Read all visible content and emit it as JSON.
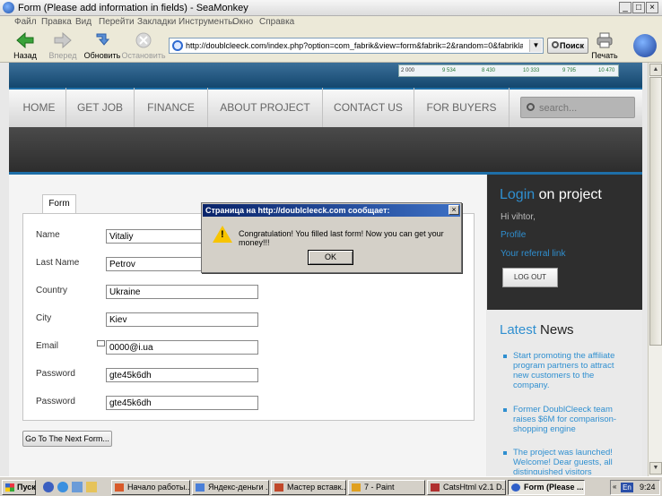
{
  "window": {
    "title": "Form (Please add information in fields) - SeaMonkey"
  },
  "menu": [
    "Файл",
    "Правка",
    "Вид",
    "Перейти",
    "Закладки",
    "Инструменты",
    "Окно",
    "Справка"
  ],
  "nav": {
    "back": "Назад",
    "forward": "Вперед",
    "reload": "Обновить",
    "stop": "Остановить",
    "url": "http://doublcleeck.com/index.php?option=com_fabrik&view=form&fabrik=2&random=0&fabriklayout=tabs&",
    "search": "Поиск",
    "print": "Печать"
  },
  "ticker": [
    "2 000",
    "9 534",
    "8 430",
    "10 333",
    "9 795",
    "10 470"
  ],
  "site": {
    "menu": [
      "HOME",
      "GET JOB",
      "FINANCE",
      "ABOUT PROJECT",
      "CONTACT US",
      "FOR BUYERS"
    ],
    "search_placeholder": "search..."
  },
  "form": {
    "tab": "Form",
    "fields": [
      {
        "label": "Name",
        "value": "Vitaliy"
      },
      {
        "label": "Last Name",
        "value": "Petrov"
      },
      {
        "label": "Country",
        "value": "Ukraine"
      },
      {
        "label": "City",
        "value": "Kiev"
      },
      {
        "label": "Email",
        "value": "0000@i.ua"
      },
      {
        "label": "Password",
        "value": "gte45k6dh"
      },
      {
        "label": "Password",
        "value": "gte45k6dh"
      }
    ],
    "next": "Go To The Next Form..."
  },
  "sidebar": {
    "login_word1": "Login",
    "login_word2": "on project",
    "greeting": "Hi vihtor,",
    "profile": "Profile",
    "referral": "Your referral link",
    "logout": "LOG OUT",
    "news_word1": "Latest",
    "news_word2": "News",
    "news": [
      "Start promoting the affiliate program partners to attract new customers to the company.",
      "Former DoublCleeck team raises $6M for comparison-shopping engine",
      "The project was launched! Welcome! Dear guests, all distinguished visitors"
    ]
  },
  "dialog": {
    "title": "Страница на http://doublcleeck.com сообщает:",
    "message": "Congratulation! You filled last form! Now you can get your money!!!",
    "ok": "OK"
  },
  "taskbar": {
    "start": "Пуск",
    "items": [
      "Начало работы...",
      "Яндекс-деньги ...",
      "Мастер вставк...",
      "7 - Paint",
      "CatsHtml v2.1 D...",
      "Form (Please ..."
    ],
    "lang": "En",
    "time": "9:24"
  },
  "colors": {
    "accent": "#1e6fa8",
    "link": "#2f8fd0",
    "dialog_title": "#0a246a"
  }
}
